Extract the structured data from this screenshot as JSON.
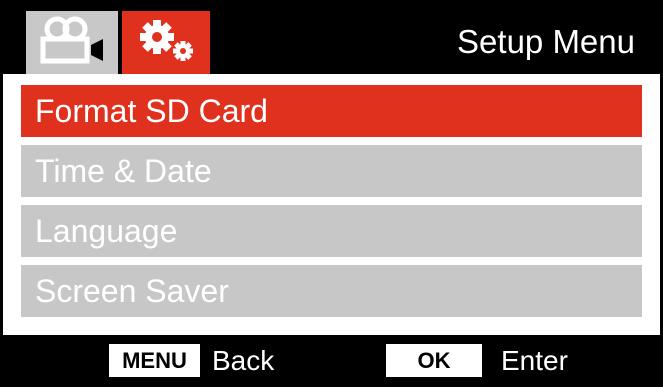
{
  "header": {
    "title": "Setup Menu",
    "tabs": [
      {
        "icon": "video-camera-icon",
        "active": false
      },
      {
        "icon": "gears-icon",
        "active": true
      }
    ]
  },
  "menu": {
    "items": [
      {
        "label": "Format SD Card",
        "selected": true
      },
      {
        "label": "Time & Date",
        "selected": false
      },
      {
        "label": "Language",
        "selected": false
      },
      {
        "label": "Screen Saver",
        "selected": false
      }
    ]
  },
  "footer": {
    "menu_key": "MENU",
    "menu_action": "Back",
    "ok_key": "OK",
    "ok_action": "Enter"
  },
  "colors": {
    "accent": "#e0301e",
    "inactive": "#c7c7c7",
    "bar": "#000000"
  }
}
